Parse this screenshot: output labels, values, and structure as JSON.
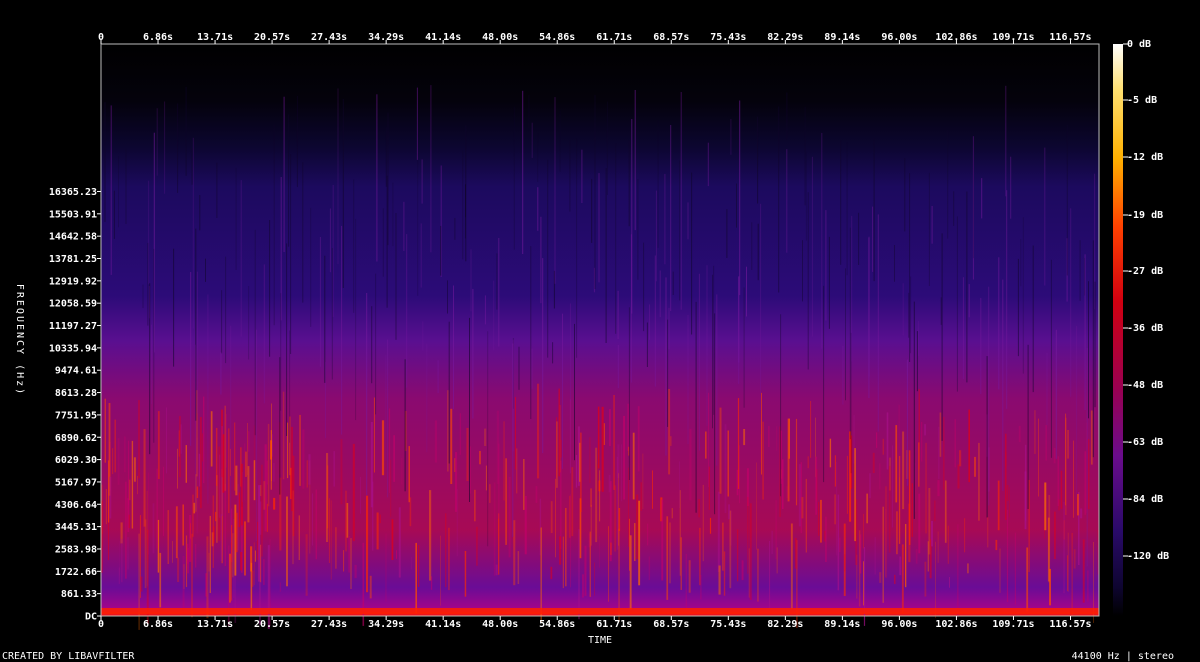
{
  "chart_data": {
    "type": "heatmap",
    "title": "",
    "xlabel": "TIME",
    "ylabel": "FREQUENCY (Hz)",
    "time_ticks": [
      "0",
      "6.86s",
      "13.71s",
      "20.57s",
      "27.43s",
      "34.29s",
      "41.14s",
      "48.00s",
      "54.86s",
      "61.71s",
      "68.57s",
      "75.43s",
      "82.29s",
      "89.14s",
      "96.00s",
      "102.86s",
      "109.71s",
      "116.57s"
    ],
    "freq_ticks": [
      "DC",
      "861.33",
      "1722.66",
      "2583.98",
      "3445.31",
      "4306.64",
      "5167.97",
      "6029.30",
      "6890.62",
      "7751.95",
      "8613.28",
      "9474.61",
      "10335.94",
      "11197.27",
      "12058.59",
      "12919.92",
      "13781.25",
      "14642.58",
      "15503.91",
      "16365.23"
    ],
    "db_ticks": [
      "0 dB",
      "-5 dB",
      "-12 dB",
      "-19 dB",
      "-27 dB",
      "-36 dB",
      "-48 dB",
      "-63 dB",
      "-84 dB",
      "-120 dB"
    ],
    "xlim": [
      0,
      120
    ],
    "ylim": [
      0,
      22050
    ],
    "colormap": [
      "#000000",
      "#140a46",
      "#2a0a7a",
      "#5a0f96",
      "#8c0a8c",
      "#c8001e",
      "#ff2000",
      "#ff8c00",
      "#ffd700",
      "#ffffff"
    ],
    "grid": false,
    "legend": "right colorbar"
  },
  "footer": {
    "credit": "CREATED BY LIBAVFILTER",
    "format": "44100 Hz | stereo"
  }
}
